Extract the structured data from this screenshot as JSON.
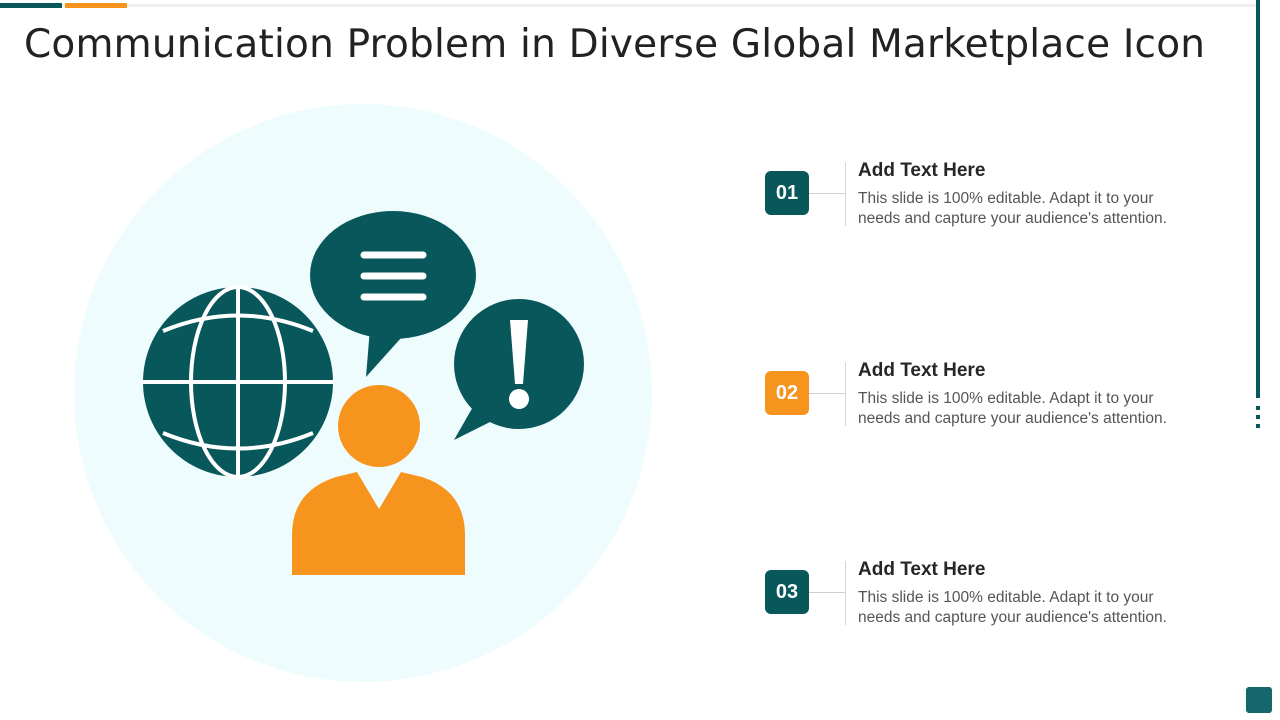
{
  "title": "Communication Problem in Diverse Global Marketplace Icon",
  "colors": {
    "teal": "#07575b",
    "orange": "#f7941d",
    "circle_bg": "#effcfd"
  },
  "illustration": {
    "icons": [
      "globe-icon",
      "speech-bubble-lines-icon",
      "speech-bubble-exclamation-icon",
      "person-icon"
    ]
  },
  "items": [
    {
      "number": "01",
      "heading": "Add Text Here",
      "text": "This slide is 100% editable. Adapt it to your needs and capture your audience's attention.",
      "color": "teal"
    },
    {
      "number": "02",
      "heading": "Add Text Here",
      "text": "This slide is 100% editable. Adapt it to your needs and capture your audience's attention.",
      "color": "orange"
    },
    {
      "number": "03",
      "heading": "Add Text Here",
      "text": "This slide is 100% editable. Adapt it to your needs and capture your audience's attention.",
      "color": "teal"
    }
  ]
}
